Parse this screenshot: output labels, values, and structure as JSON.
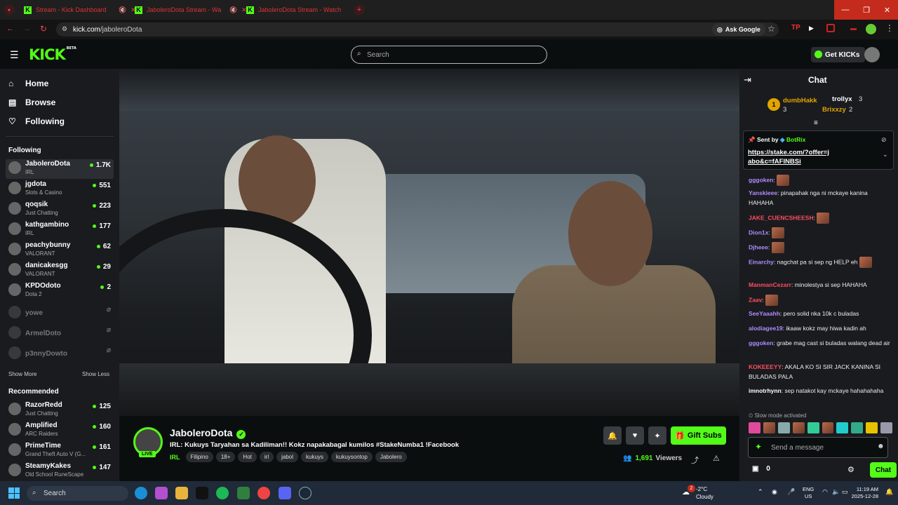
{
  "browser": {
    "tabs": [
      {
        "title": "Stream - Kick Dashboard"
      },
      {
        "title": "JaboleroDota Stream - Wa"
      },
      {
        "title": "JaboleroDota Stream - Watch"
      }
    ],
    "url_host": "kick.com",
    "url_path": "/jaboleroDota",
    "ask_google": "Ask Google"
  },
  "header": {
    "logo": "KICK",
    "logo_beta": "BETA",
    "search_placeholder": "Search",
    "get_kicks": "Get KICKs"
  },
  "sidebar": {
    "nav": [
      {
        "label": "Home"
      },
      {
        "label": "Browse"
      },
      {
        "label": "Following"
      }
    ],
    "following_heading": "Following",
    "following": [
      {
        "name": "JaboleroDota",
        "category": "IRL",
        "viewers": "1.7K"
      },
      {
        "name": "jgdota",
        "category": "Slots & Casino",
        "viewers": "551"
      },
      {
        "name": "qoqsik",
        "category": "Just Chatting",
        "viewers": "223"
      },
      {
        "name": "kathgambino",
        "category": "IRL",
        "viewers": "177"
      },
      {
        "name": "peachybunny",
        "category": "VALORANT",
        "viewers": "62"
      },
      {
        "name": "danicakesgg",
        "category": "VALORANT",
        "viewers": "29"
      },
      {
        "name": "KPDOdoto",
        "category": "Dota 2",
        "viewers": "2"
      }
    ],
    "offline": [
      {
        "name": "yowe"
      },
      {
        "name": "ArmelDoto"
      },
      {
        "name": "p3nnyDowto"
      }
    ],
    "show_more": "Show More",
    "show_less": "Show Less",
    "recommended_heading": "Recommended",
    "recommended": [
      {
        "name": "RazorRedd",
        "category": "Just Chatting",
        "viewers": "125"
      },
      {
        "name": "Amplified",
        "category": "ARC Raiders",
        "viewers": "160"
      },
      {
        "name": "PrimeTime",
        "category": "Grand Theft Auto V (G...",
        "viewers": "161"
      },
      {
        "name": "SteamyKakes",
        "category": "Old School RuneScape",
        "viewers": "147"
      }
    ]
  },
  "stream": {
    "channel": "JaboleroDota",
    "live_badge": "LIVE",
    "title": "IRL: Kukuys Taryahan sa Kadiliman!! Kokz napakabagal kumilos #StakeNumba1 !Facebook",
    "category": "IRL",
    "tags": [
      "Filipino",
      "18+",
      "Hot",
      "irl",
      "jabol",
      "kukuys",
      "kukuysontop",
      "Jabolero"
    ],
    "viewers": "1,691",
    "viewers_label": "Viewers",
    "gift_subs": "Gift Subs"
  },
  "chat": {
    "title": "Chat",
    "leaderboard": [
      {
        "rank": "1",
        "name": "dumbHakk",
        "count": "3"
      },
      {
        "name": "trollyx",
        "count": "3"
      },
      {
        "name": "Brixxzy",
        "count": "2"
      }
    ],
    "pinned": {
      "sent_by": "Sent by",
      "bot": "BotRix",
      "link": "https://stake.com/?offer=jabo&c=fAFINBSi"
    },
    "messages": [
      {
        "user": "gggoken",
        "text": "",
        "color": "#b18cff"
      },
      {
        "user": "Yanskieee",
        "text": "pinapahak nga ni mckaye kanina HAHAHA",
        "color": "#b18cff"
      },
      {
        "user": "JAKE_CUENCSHEESH",
        "text": "",
        "color": "#ff4d5e"
      },
      {
        "user": "Dion1x",
        "text": "",
        "color": "#b18cff"
      },
      {
        "user": "Djheee",
        "text": "",
        "color": "#b18cff"
      },
      {
        "user": "Einarchy",
        "text": "nagchat pa si sep ng HELP eh",
        "color": "#b18cff"
      },
      {
        "user": "ManmanCezarr",
        "text": "minolestya si sep HAHAHA",
        "color": "#ff4d5e"
      },
      {
        "user": "Zaav",
        "text": "",
        "color": "#ff4d5e"
      },
      {
        "user": "SeeYaaahh",
        "text": "pero solid nka 10k c buladas",
        "color": "#b18cff"
      },
      {
        "user": "alodiagee19",
        "text": "ikaaw kokz may hiwa kadin ah",
        "color": "#b18cff"
      },
      {
        "user": "gggoken",
        "text": "grabe mag cast si buladas walang dead air",
        "color": "#b18cff"
      },
      {
        "user": "KOKEEEYY",
        "text": "AKALA KO SI SIR JACK KANINA SI BULADAS PALA",
        "color": "#ff4d5e"
      },
      {
        "user": "imnotrhynn",
        "text": "sep natakot kay mckaye hahahahaha",
        "color": "#fff"
      }
    ],
    "slow_mode": "Slow mode activated",
    "send_placeholder": "Send a message",
    "count": "0",
    "chat_button": "Chat"
  },
  "taskbar": {
    "search": "Search",
    "weather_temp": "-2°C",
    "weather_desc": "Cloudy",
    "weather_badge": "2",
    "lang1": "ENG",
    "lang2": "US",
    "time": "11:19 AM",
    "date": "2025-12-28"
  },
  "colors": {
    "accent": "#53fc18",
    "bg": "#0b0e0f",
    "panel": "#191b1f"
  }
}
